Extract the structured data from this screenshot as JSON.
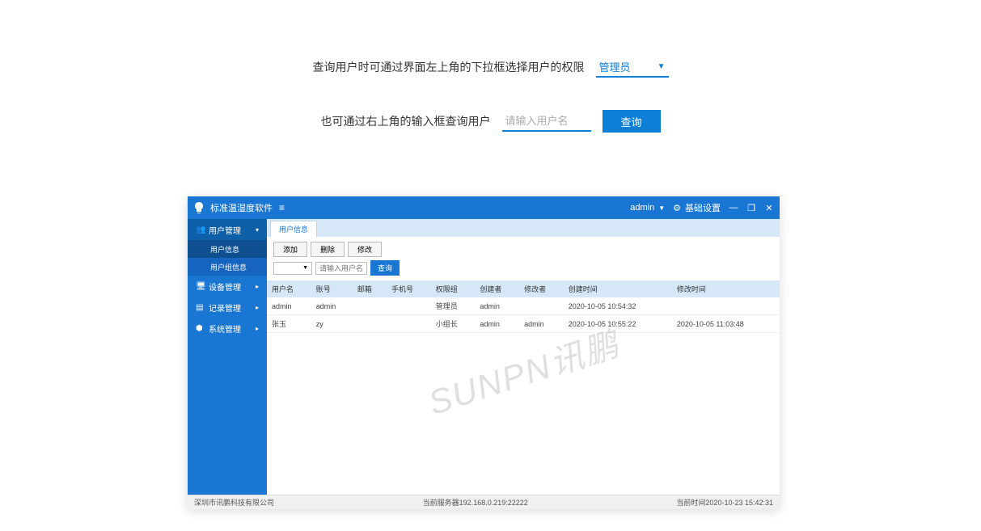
{
  "instructions": {
    "row1_text": "查询用户时可通过界面左上角的下拉框选择用户的权限",
    "row1_dropdown": "管理员",
    "row2_text": "也可通过右上角的输入框查询用户",
    "row2_placeholder": "请输入用户名",
    "row2_btn": "查询"
  },
  "app": {
    "title": "标准温湿度软件",
    "user_label": "admin",
    "settings_label": "基础设置"
  },
  "sidebar": {
    "items": [
      {
        "label": "用户管理",
        "icon": "👥"
      },
      {
        "label": "用户信息",
        "sub": true
      },
      {
        "label": "用户组信息",
        "sub": true
      },
      {
        "label": "设备管理",
        "icon": "🖥"
      },
      {
        "label": "记录管理",
        "icon": "📄"
      },
      {
        "label": "系统管理",
        "icon": "⚙"
      }
    ]
  },
  "tab": {
    "label": "用户信息"
  },
  "toolbar": {
    "add": "添加",
    "delete": "删除",
    "modify": "修改",
    "search_placeholder": "请输入用户名",
    "query": "查询"
  },
  "table": {
    "headers": [
      "用户名",
      "账号",
      "邮箱",
      "手机号",
      "权限组",
      "创建者",
      "修改者",
      "创建时间",
      "修改时间"
    ],
    "rows": [
      [
        "admin",
        "admin",
        "",
        "",
        "管理员",
        "admin",
        "",
        "2020-10-05 10:54:32",
        ""
      ],
      [
        "张玉",
        "zy",
        "",
        "",
        "小组长",
        "admin",
        "admin",
        "2020-10-05 10:55:22",
        "2020-10-05 11:03:48"
      ]
    ]
  },
  "watermark": "SUNPN讯鹏",
  "statusbar": {
    "company": "深圳市讯鹏科技有限公司",
    "server": "当前服务器192.168.0.219:22222",
    "time": "当前时间2020-10-23 15:42:31"
  }
}
